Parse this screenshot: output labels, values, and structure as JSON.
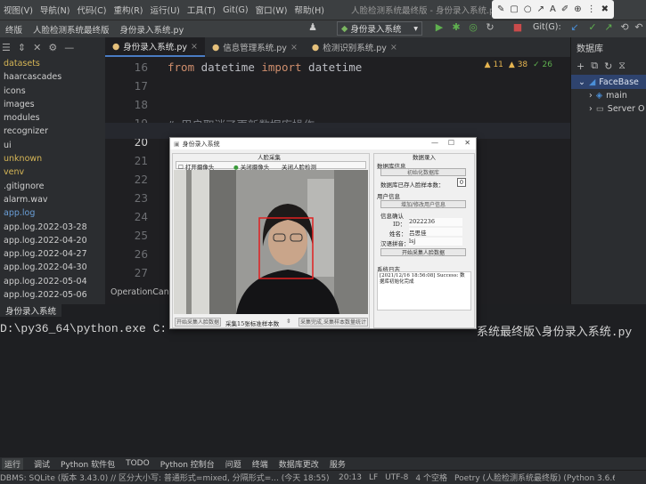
{
  "menubar": {
    "items": [
      "视图(V)",
      "导航(N)",
      "代码(C)",
      "重构(R)",
      "运行(U)",
      "工具(T)",
      "Git(G)",
      "窗口(W)",
      "帮助(H)"
    ],
    "app_title": "人脸检测系统最终版 - 身份录入系统.py"
  },
  "toolbar": {
    "breadcrumbs": [
      "终版",
      "人脸检测系统最终版",
      "身份录入系统.py"
    ],
    "run_config": "身份录入系统",
    "git_label": "Git(G):"
  },
  "project": {
    "items": [
      "datasets",
      "haarcascades",
      "icons",
      "images",
      "modules",
      "recognizer",
      "ui",
      "unknown",
      "venv",
      ".gitignore",
      "alarm.wav",
      "app.log",
      "app.log.2022-03-28",
      "app.log.2022-04-20",
      "app.log.2022-04-27",
      "app.log.2022-04-30",
      "app.log.2022-05-04",
      "app.log.2022-05-06"
    ]
  },
  "editor": {
    "tabs": [
      "身份录入系统.py",
      "信息管理系统.py",
      "检测识别系统.py"
    ],
    "line_numbers": [
      "16",
      "17",
      "18",
      "19",
      "20",
      "21",
      "22",
      "23",
      "24",
      "25",
      "26",
      "27"
    ],
    "code_line1_kw1": "from",
    "code_line1_mod": " datetime ",
    "code_line1_kw2": "import",
    "code_line1_name": " datetime",
    "comment": "# 用户取消了更新数据库操作",
    "footer_text": "OperationCanc",
    "inspect_warn": "▲ 11",
    "inspect_weak": "▲ 38",
    "inspect_typo": "✓ 26"
  },
  "database": {
    "title": "数据库",
    "root": "FaceBase",
    "child1": "main",
    "child2": "Server O"
  },
  "run": {
    "tab": "身份录入系统",
    "cmd": "D:\\py36_64\\python.exe C:",
    "cmd_tail": "系统最终版\\身份录入系统.py"
  },
  "tooltabs": [
    "运行",
    "调试",
    "Python 软件包",
    "TODO",
    "Python 控制台",
    "问题",
    "终端",
    "数据库更改",
    "服务"
  ],
  "status": {
    "left": "DBMS: SQLite (版本 3.43.0) // 区分大小写: 普通形式=mixed, 分隔形式=... (今天 18:55)",
    "pos": "20:13",
    "eol": "LF",
    "enc": "UTF-8",
    "indent": "4 个空格",
    "interpreter": "Poetry (人脸检测系统最终版) (Python 3.6.6)"
  },
  "dialog": {
    "title": "身份录入系统",
    "camera_group": "人脸采集",
    "open_cam": "打开摄像头",
    "face_detect": "关闭摄像头",
    "close_detect": "关闭人脸检测",
    "data_group": "数据录入",
    "db_info_label": "数据库信息",
    "init_db": "初始化数据库",
    "db_count": "数据库已存人脸样本数：",
    "db_count_value": "0",
    "user_info_label": "用户信息",
    "add_user": "增加/修改用户信息",
    "confirm_label": "信息确认",
    "id_label": "ID：",
    "id_value": "2022236",
    "name_label": "姓名：",
    "name_value": "吕思佳",
    "pinyin_label": "汉语拼音：",
    "pinyin_value": "lsj",
    "start_btn": "开始采集人脸数据",
    "log_label": "系统日志",
    "log_text": "[2021/12/16 18:56:08] Success: 数据库初始化完成",
    "btn_sample": "开始采集人脸数据",
    "btn_sample2": "采集15张标准样本数",
    "btn_stop": "采集完成,采集样本数量统计"
  }
}
